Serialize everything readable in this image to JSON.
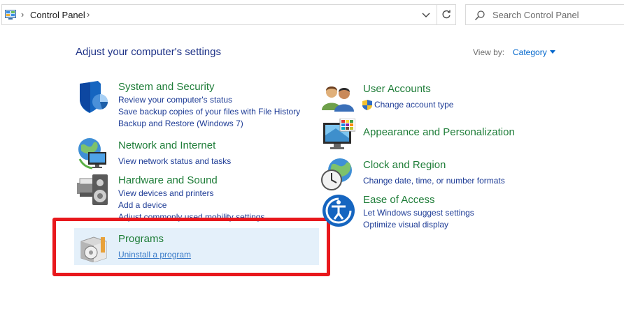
{
  "address_bar": {
    "crumb": "Control Panel"
  },
  "search": {
    "placeholder": "Search Control Panel"
  },
  "header": {
    "title": "Adjust your computer's settings",
    "view_by_label": "View by:",
    "view_by_value": "Category"
  },
  "left_categories": [
    {
      "title": "System and Security",
      "links": [
        "Review your computer's status",
        "Save backup copies of your files with File History",
        "Backup and Restore (Windows 7)"
      ]
    },
    {
      "title": "Network and Internet",
      "links": [
        "View network status and tasks"
      ]
    },
    {
      "title": "Hardware and Sound",
      "links": [
        "View devices and printers",
        "Add a device",
        "Adjust commonly used mobility settings"
      ]
    },
    {
      "title": "Programs",
      "links": [
        "Uninstall a program"
      ]
    }
  ],
  "right_categories": [
    {
      "title": "User Accounts",
      "links": [
        "Change account type"
      ]
    },
    {
      "title": "Appearance and Personalization",
      "links": []
    },
    {
      "title": "Clock and Region",
      "links": [
        "Change date, time, or number formats"
      ]
    },
    {
      "title": "Ease of Access",
      "links": [
        "Let Windows suggest settings",
        "Optimize visual display"
      ]
    }
  ],
  "colors": {
    "category_title": "#1e7d38",
    "link": "#1e3c96",
    "highlight": "#e4f0fa",
    "annotation_box": "#e8181c"
  }
}
